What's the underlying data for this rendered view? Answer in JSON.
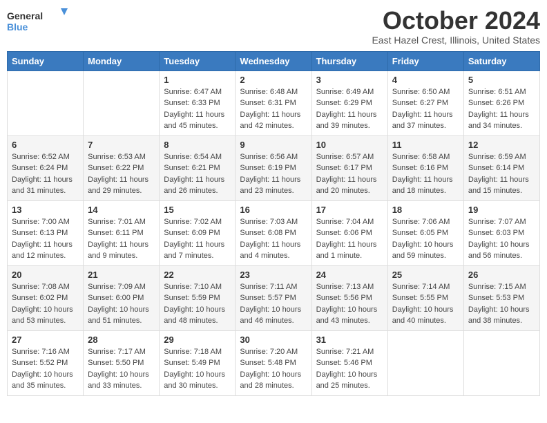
{
  "header": {
    "logo_general": "General",
    "logo_blue": "Blue",
    "month_title": "October 2024",
    "location": "East Hazel Crest, Illinois, United States"
  },
  "days_of_week": [
    "Sunday",
    "Monday",
    "Tuesday",
    "Wednesday",
    "Thursday",
    "Friday",
    "Saturday"
  ],
  "weeks": [
    [
      {
        "day": "",
        "info": ""
      },
      {
        "day": "",
        "info": ""
      },
      {
        "day": "1",
        "info": "Sunrise: 6:47 AM\nSunset: 6:33 PM\nDaylight: 11 hours and 45 minutes."
      },
      {
        "day": "2",
        "info": "Sunrise: 6:48 AM\nSunset: 6:31 PM\nDaylight: 11 hours and 42 minutes."
      },
      {
        "day": "3",
        "info": "Sunrise: 6:49 AM\nSunset: 6:29 PM\nDaylight: 11 hours and 39 minutes."
      },
      {
        "day": "4",
        "info": "Sunrise: 6:50 AM\nSunset: 6:27 PM\nDaylight: 11 hours and 37 minutes."
      },
      {
        "day": "5",
        "info": "Sunrise: 6:51 AM\nSunset: 6:26 PM\nDaylight: 11 hours and 34 minutes."
      }
    ],
    [
      {
        "day": "6",
        "info": "Sunrise: 6:52 AM\nSunset: 6:24 PM\nDaylight: 11 hours and 31 minutes."
      },
      {
        "day": "7",
        "info": "Sunrise: 6:53 AM\nSunset: 6:22 PM\nDaylight: 11 hours and 29 minutes."
      },
      {
        "day": "8",
        "info": "Sunrise: 6:54 AM\nSunset: 6:21 PM\nDaylight: 11 hours and 26 minutes."
      },
      {
        "day": "9",
        "info": "Sunrise: 6:56 AM\nSunset: 6:19 PM\nDaylight: 11 hours and 23 minutes."
      },
      {
        "day": "10",
        "info": "Sunrise: 6:57 AM\nSunset: 6:17 PM\nDaylight: 11 hours and 20 minutes."
      },
      {
        "day": "11",
        "info": "Sunrise: 6:58 AM\nSunset: 6:16 PM\nDaylight: 11 hours and 18 minutes."
      },
      {
        "day": "12",
        "info": "Sunrise: 6:59 AM\nSunset: 6:14 PM\nDaylight: 11 hours and 15 minutes."
      }
    ],
    [
      {
        "day": "13",
        "info": "Sunrise: 7:00 AM\nSunset: 6:13 PM\nDaylight: 11 hours and 12 minutes."
      },
      {
        "day": "14",
        "info": "Sunrise: 7:01 AM\nSunset: 6:11 PM\nDaylight: 11 hours and 9 minutes."
      },
      {
        "day": "15",
        "info": "Sunrise: 7:02 AM\nSunset: 6:09 PM\nDaylight: 11 hours and 7 minutes."
      },
      {
        "day": "16",
        "info": "Sunrise: 7:03 AM\nSunset: 6:08 PM\nDaylight: 11 hours and 4 minutes."
      },
      {
        "day": "17",
        "info": "Sunrise: 7:04 AM\nSunset: 6:06 PM\nDaylight: 11 hours and 1 minute."
      },
      {
        "day": "18",
        "info": "Sunrise: 7:06 AM\nSunset: 6:05 PM\nDaylight: 10 hours and 59 minutes."
      },
      {
        "day": "19",
        "info": "Sunrise: 7:07 AM\nSunset: 6:03 PM\nDaylight: 10 hours and 56 minutes."
      }
    ],
    [
      {
        "day": "20",
        "info": "Sunrise: 7:08 AM\nSunset: 6:02 PM\nDaylight: 10 hours and 53 minutes."
      },
      {
        "day": "21",
        "info": "Sunrise: 7:09 AM\nSunset: 6:00 PM\nDaylight: 10 hours and 51 minutes."
      },
      {
        "day": "22",
        "info": "Sunrise: 7:10 AM\nSunset: 5:59 PM\nDaylight: 10 hours and 48 minutes."
      },
      {
        "day": "23",
        "info": "Sunrise: 7:11 AM\nSunset: 5:57 PM\nDaylight: 10 hours and 46 minutes."
      },
      {
        "day": "24",
        "info": "Sunrise: 7:13 AM\nSunset: 5:56 PM\nDaylight: 10 hours and 43 minutes."
      },
      {
        "day": "25",
        "info": "Sunrise: 7:14 AM\nSunset: 5:55 PM\nDaylight: 10 hours and 40 minutes."
      },
      {
        "day": "26",
        "info": "Sunrise: 7:15 AM\nSunset: 5:53 PM\nDaylight: 10 hours and 38 minutes."
      }
    ],
    [
      {
        "day": "27",
        "info": "Sunrise: 7:16 AM\nSunset: 5:52 PM\nDaylight: 10 hours and 35 minutes."
      },
      {
        "day": "28",
        "info": "Sunrise: 7:17 AM\nSunset: 5:50 PM\nDaylight: 10 hours and 33 minutes."
      },
      {
        "day": "29",
        "info": "Sunrise: 7:18 AM\nSunset: 5:49 PM\nDaylight: 10 hours and 30 minutes."
      },
      {
        "day": "30",
        "info": "Sunrise: 7:20 AM\nSunset: 5:48 PM\nDaylight: 10 hours and 28 minutes."
      },
      {
        "day": "31",
        "info": "Sunrise: 7:21 AM\nSunset: 5:46 PM\nDaylight: 10 hours and 25 minutes."
      },
      {
        "day": "",
        "info": ""
      },
      {
        "day": "",
        "info": ""
      }
    ]
  ]
}
